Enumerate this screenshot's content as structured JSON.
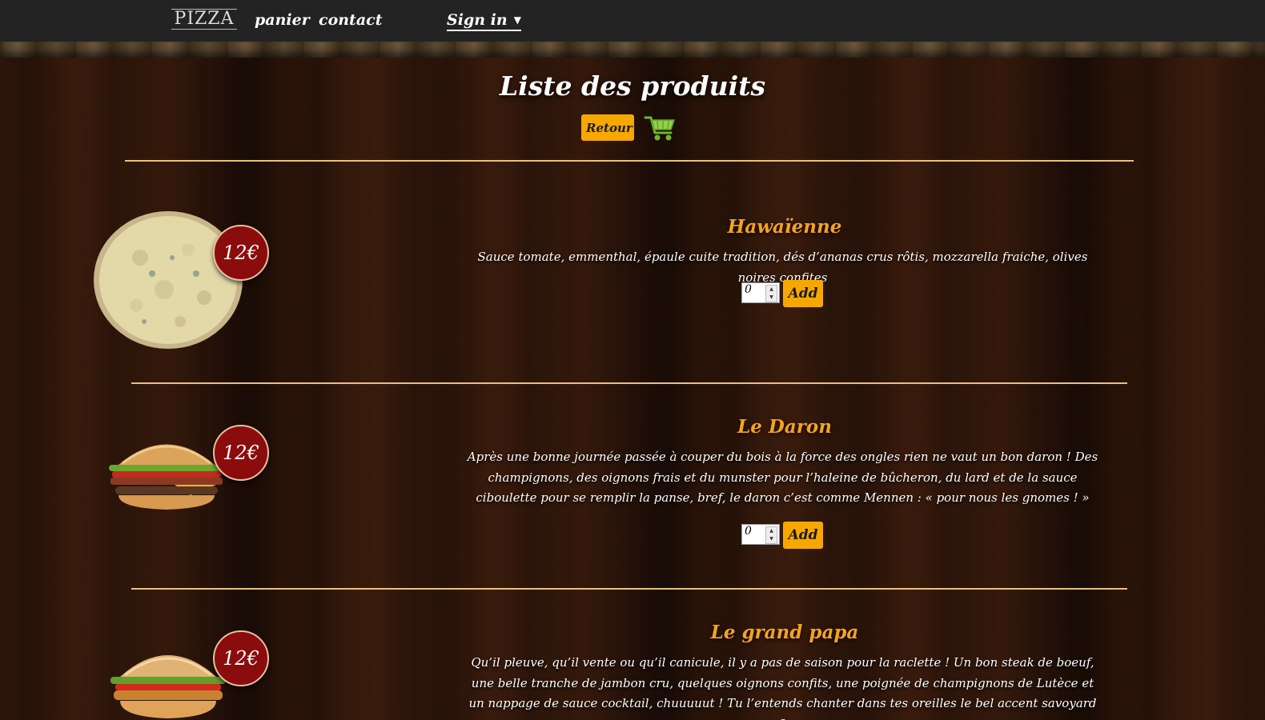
{
  "nav": {
    "logo": "PIZZA",
    "links": [
      "panier",
      "contact"
    ],
    "signin": "Sign in"
  },
  "header": {
    "title": "Liste des produits",
    "back_label": "Retour",
    "cart_icon": "shopping-cart-icon"
  },
  "products": [
    {
      "name": "Hawaïenne",
      "price": "12€",
      "description": "Sauce tomate, emmenthal, épaule cuite tradition, dés d’ananas crus rôtis, mozzarella fraiche, olives noires confites",
      "qty": "0",
      "add_label": "Add"
    },
    {
      "name": "Le Daron",
      "price": "12€",
      "description": "Après une bonne journée passée à couper du bois à la force des ongles rien ne vaut un bon daron ! Des champignons, des oignons frais et du munster pour l’haleine de bûcheron, du lard et de la sauce ciboulette pour se remplir la panse, bref, le daron c’est comme Mennen : « pour nous les gnomes ! »",
      "qty": "0",
      "add_label": "Add"
    },
    {
      "name": "Le grand papa",
      "price": "12€",
      "description": "Qu’il pleuve, qu’il vente ou qu’il canicule, il y a pas de saison pour la raclette ! Un bon steak de boeuf, une belle tranche de jambon cru, quelques oignons confits, une poignée de champignons de Lutèce et un nappage de sauce cocktail, chuuuuut ! Tu l’entends chanter dans tes oreilles le bel accent savoyard ?"
    }
  ],
  "colors": {
    "accent": "#f7a800",
    "product_title": "#f5a31e",
    "price_badge": "#8b0c0c",
    "divider": "#e9c179"
  }
}
